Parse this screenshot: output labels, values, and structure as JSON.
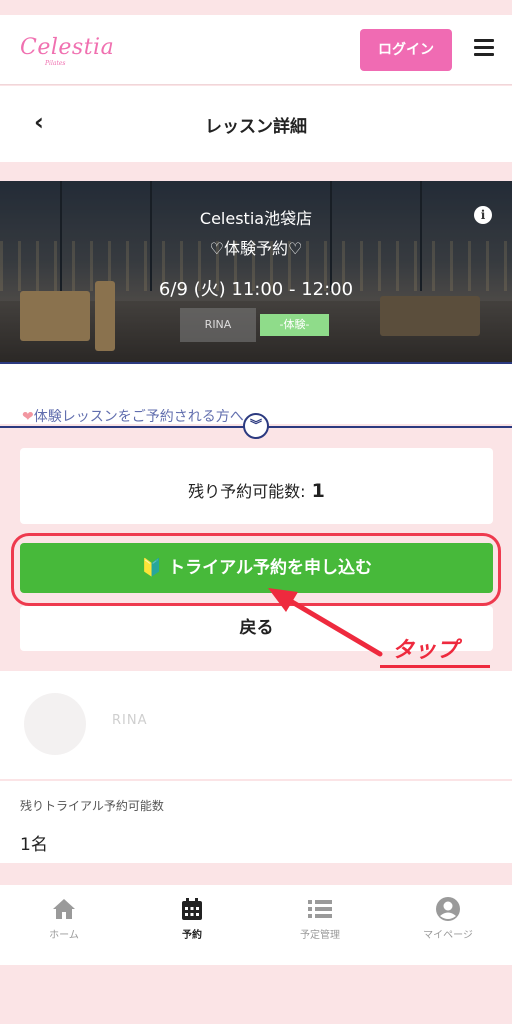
{
  "header": {
    "logo": "Celestia",
    "logo_sub": "Pilates",
    "login_label": "ログイン",
    "menu_icon": "hamburger-menu-icon"
  },
  "titlebar": {
    "back_icon": "chevron-left-icon",
    "title": "レッスン詳細"
  },
  "lesson": {
    "store": "Celestia池袋店",
    "event": "♡体験予約♡",
    "datetime": "6/9 (火) 11:00 - 12:00",
    "instructor_badge": "RINA",
    "type_badge": "-体験-"
  },
  "notice": {
    "text": "体験レッスンをご予約される方へ"
  },
  "reservation": {
    "remaining_label": "残り予約可能数:",
    "remaining_value": "1",
    "cta_label": "トライアル予約を申し込む",
    "back_label": "戻る"
  },
  "annotation": {
    "tap_label": "タップ",
    "color": "#ee2a3e"
  },
  "instructor": {
    "name": "RINA"
  },
  "trial": {
    "label": "残りトライアル予約可能数",
    "value": "1名"
  },
  "nav": {
    "items": [
      {
        "label": "ホーム",
        "icon": "home-icon"
      },
      {
        "label": "予約",
        "icon": "calendar-icon"
      },
      {
        "label": "予定管理",
        "icon": "list-icon"
      },
      {
        "label": "マイページ",
        "icon": "user-icon"
      }
    ]
  },
  "colors": {
    "brand_pink": "#f06bb3",
    "cta_green": "#47b93a",
    "navy": "#2c3a80",
    "background": "#fbe4e6"
  }
}
